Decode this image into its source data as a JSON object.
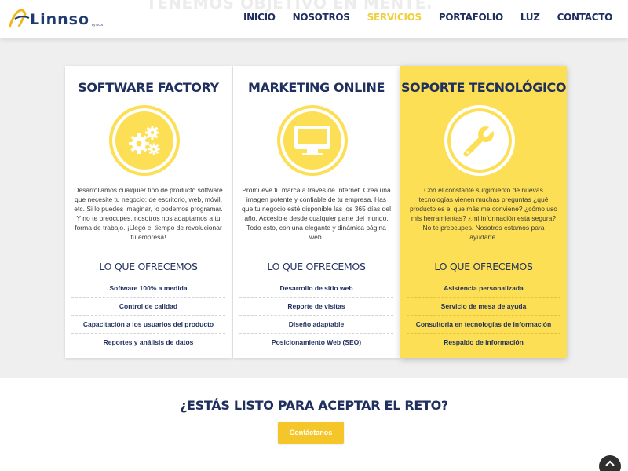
{
  "header": {
    "ghost_text": "TENEMOS OBJETIVO EN MENTE.",
    "logo_text": "Linnso",
    "logo_sub": "by DGA",
    "nav": [
      {
        "label": "INICIO",
        "active": false
      },
      {
        "label": "NOSOTROS",
        "active": false
      },
      {
        "label": "SERVICIOS",
        "active": true
      },
      {
        "label": "PORTAFOLIO",
        "active": false
      },
      {
        "label": "LUZ",
        "active": false
      },
      {
        "label": "CONTACTO",
        "active": false
      }
    ]
  },
  "colors": {
    "accent": "#fddf55",
    "navy": "#1f2f5e",
    "button": "#f5c62a"
  },
  "services": [
    {
      "title": "SOFTWARE FACTORY",
      "icon": "gears-icon",
      "highlight": false,
      "description": "Desarrollamos cualquier tipo de producto software que necesite tu negocio: de escritorio, web, móvil, etc. Si lo puedes imaginar, lo podemos programar. Y no te preocupes, nosotros nos adaptamos a tu forma de trabajo. ¡Llegó el tiempo de revolucionar tu empresa!",
      "offer_heading": "LO QUE OFRECEMOS",
      "offers": [
        "Software 100% a medida",
        "Control de calidad",
        "Capacitación a los usuarios del producto",
        "Reportes y análisis de datos"
      ]
    },
    {
      "title": "MARKETING ONLINE",
      "icon": "monitor-icon",
      "highlight": false,
      "description": "Promueve tu marca a través de Internet. Crea una imagen potente y confiable de tu empresa. Has que tu negocio esté disponible las los 365 días del año. Accesible desde cualquier parte del mundo. Todo esto, con una elegante y dinámica página web.",
      "offer_heading": "LO QUE OFRECEMOS",
      "offers": [
        "Desarrollo de sitio web",
        "Reporte de visitas",
        "Diseño adaptable",
        "Posicionamiento Web (SEO)"
      ]
    },
    {
      "title": "SOPORTE TECNOLÓGICO",
      "icon": "wrench-icon",
      "highlight": true,
      "description": "Con el constante surgimiento de nuevas tecnologías vienen muchas preguntas ¿qué producto es el que más me conviene? ¿cómo uso mis herramientas? ¿mi información esta segura? No te preocupes. Nosotros estamos para ayudarte.",
      "offer_heading": "LO QUE OFRECEMOS",
      "offers": [
        "Asistencia personalizada",
        "Servicio de mesa de ayuda",
        "Consultoria en tecnologías de información",
        "Respaldo de información"
      ]
    }
  ],
  "cta": {
    "title": "¿ESTÁS LISTO PARA ACEPTAR EL RETO?",
    "button_label": "Contáctanos"
  },
  "scroll_top_icon": "chevron-up-icon"
}
